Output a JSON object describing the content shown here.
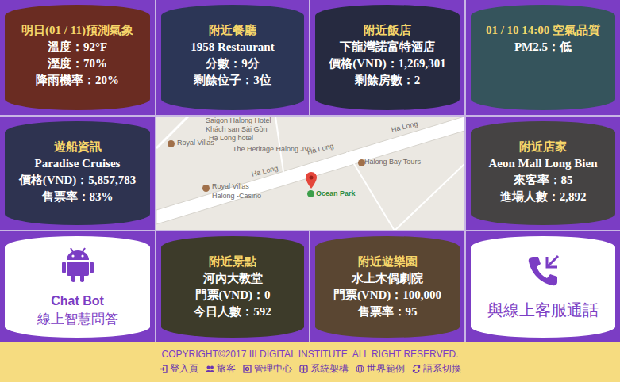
{
  "tiles": [
    {
      "kind": "info",
      "title": "明日(01 / 11)預測氣象",
      "lines": [
        "溫度：92°F",
        "溼度：70%",
        "降雨機率：20%"
      ]
    },
    {
      "kind": "info",
      "title": "附近餐廳",
      "lines": [
        "1958 Restaurant",
        "分數：9分",
        "剩餘位子：3位"
      ]
    },
    {
      "kind": "info",
      "title": "附近飯店",
      "lines": [
        "下龍灣諾富特酒店",
        "價格(VND)：1,269,301",
        "剩餘房數：2"
      ]
    },
    {
      "kind": "info",
      "title": "01 / 10 14:00 空氣品質",
      "lines": [
        "PM2.5：低"
      ]
    },
    {
      "kind": "info",
      "title": "遊船資訊",
      "lines": [
        "Paradise Cruises",
        "價格(VND)：5,857,783",
        "售票率：83%"
      ]
    },
    {
      "kind": "map",
      "labels": [
        "Saigon Halong Hotel",
        "Khách sạn Sài Gòn",
        "Hạ Long hotel",
        "Royal Villas",
        "The Heritage Halong JVC",
        "Ha Long",
        "Ha Long",
        "Ha Long",
        "Halong Bay Tours",
        "Royal Villas",
        "Halong -Casino"
      ],
      "pin": "Ocean Park"
    },
    {
      "kind": "info",
      "title": "附近店家",
      "lines": [
        "Aeon Mall Long Bien",
        "來客率：85",
        "進場人數：2,892"
      ]
    },
    {
      "kind": "chatbot",
      "lines": [
        "Chat Bot",
        "線上智慧問答"
      ]
    },
    {
      "kind": "info",
      "title": "附近景點",
      "lines": [
        "河內大教堂",
        "門票(VND)：0",
        "今日人數：592"
      ]
    },
    {
      "kind": "info",
      "title": "附近遊樂園",
      "lines": [
        "水上木偶劇院",
        "門票(VND)：100,000",
        "售票率：95"
      ]
    },
    {
      "kind": "call",
      "lines": [
        "與線上客服通話"
      ]
    }
  ],
  "footer": {
    "copyright": "COPYRIGHT©2017 III DIGITAL INSTITUTE. ALL RIGHT RESERVED.",
    "links": [
      {
        "label": "登入頁"
      },
      {
        "label": "旅客"
      },
      {
        "label": "管理中心"
      },
      {
        "label": "系統架構"
      },
      {
        "label": "世界範例"
      },
      {
        "label": "語系切換"
      }
    ]
  }
}
